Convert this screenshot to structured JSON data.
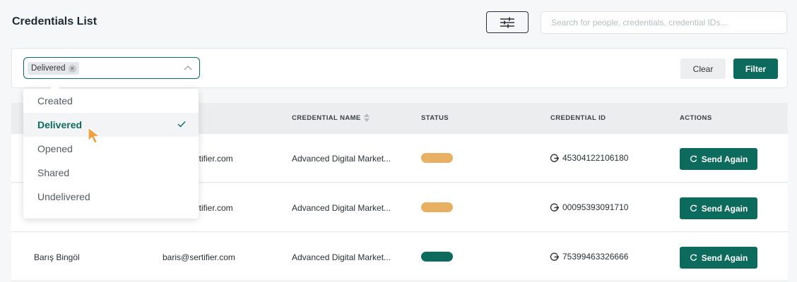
{
  "header": {
    "title": "Credentials List",
    "search_placeholder": "Search for people, credentials, credential IDs..."
  },
  "filter": {
    "selected_chip": "Delivered",
    "clear_label": "Clear",
    "filter_label": "Filter",
    "options": [
      {
        "label": "Created",
        "selected": false
      },
      {
        "label": "Delivered",
        "selected": true
      },
      {
        "label": "Opened",
        "selected": false
      },
      {
        "label": "Shared",
        "selected": false
      },
      {
        "label": "Undelivered",
        "selected": false
      }
    ]
  },
  "table": {
    "columns": [
      "CREDENTIAL NAME",
      "STATUS",
      "CREDENTIAL ID",
      "ACTIONS"
    ],
    "rows": [
      {
        "name": "",
        "email": "ertifier.com",
        "credential": "Advanced Digital Market...",
        "status_color": "#e8b062",
        "credential_id": "45304122106180",
        "action": "Send Again"
      },
      {
        "name": "",
        "email": "ertifier.com",
        "credential": "Advanced Digital Market...",
        "status_color": "#e8b062",
        "credential_id": "00095393091710",
        "action": "Send Again"
      },
      {
        "name": "Barış Bingöl",
        "email": "baris@sertifier.com",
        "credential": "Advanced Digital Market...",
        "status_color": "#0d6b5e",
        "credential_id": "75399463326666",
        "action": "Send Again"
      }
    ]
  },
  "colors": {
    "accent": "#0d6b5e",
    "status_pending": "#e8b062",
    "status_delivered": "#0d6b5e",
    "cursor": "#f0a040"
  },
  "icons": [
    "sliders-icon",
    "chevron-up-icon",
    "sort-icon",
    "refresh-icon",
    "redirect-icon",
    "check-icon",
    "cursor-icon"
  ]
}
